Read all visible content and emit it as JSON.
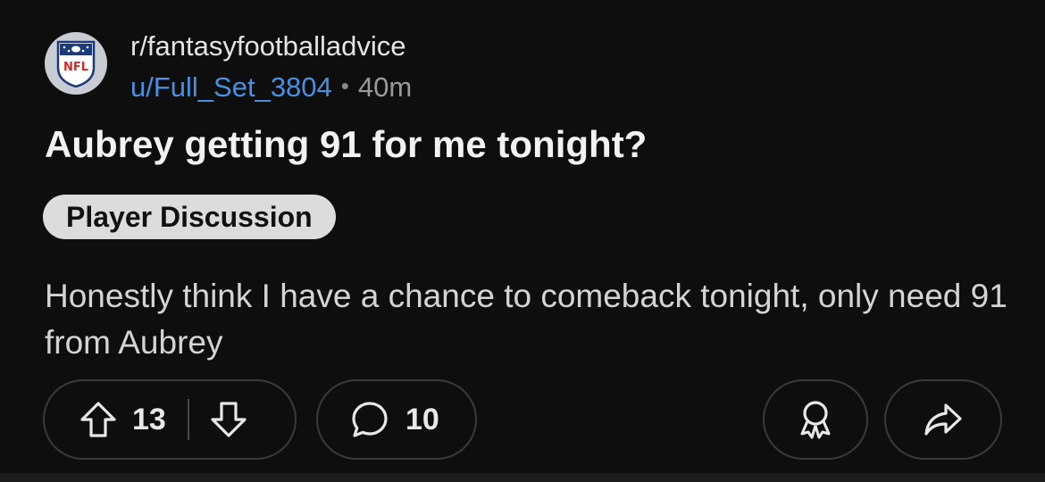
{
  "post": {
    "subreddit": "r/fantasyfootballadvice",
    "username": "u/Full_Set_3804",
    "separator": "•",
    "age": "40m",
    "title": "Aubrey getting 91 for me tonight?",
    "flair": "Player Discussion",
    "body": "Honestly think I have a chance to comeback tonight, only need 91 from Aubrey",
    "avatar_logo_text": "NFL"
  },
  "actions": {
    "upvote_count": "13",
    "comment_count": "10"
  },
  "colors": {
    "background": "#0e0e0e",
    "username": "#4a90e2",
    "flair_bg": "#dcdcdc",
    "pill_border": "#3a3a3a"
  },
  "icons": {
    "avatar": "nfl-shield-logo",
    "upvote": "arrow-up-outline-icon",
    "downvote": "arrow-down-outline-icon",
    "comment": "speech-bubble-icon",
    "award": "award-ribbon-icon",
    "share": "share-arrow-icon"
  }
}
